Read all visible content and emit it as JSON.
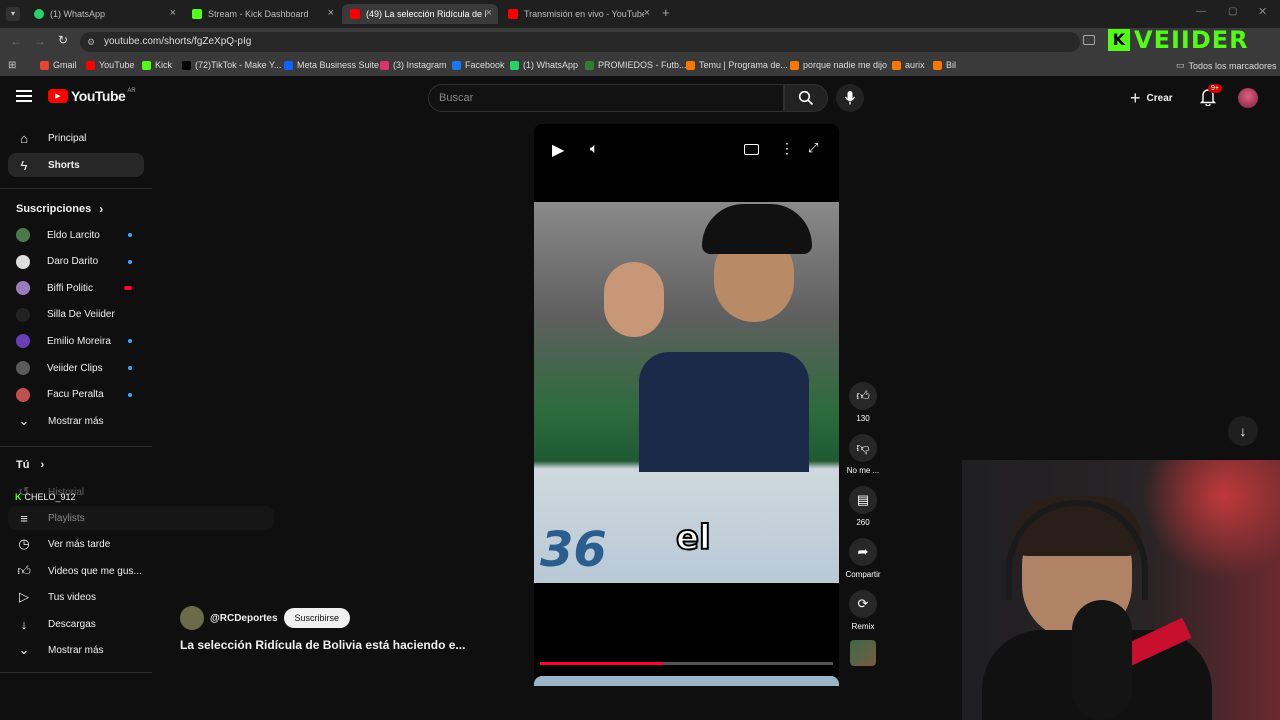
{
  "browser": {
    "tabs": [
      {
        "label": "(1) WhatsApp",
        "color": "#25d366"
      },
      {
        "label": "Stream - Kick Dashboard",
        "color": "#53fc18"
      },
      {
        "label": "(49) La selección Ridícula de Bo",
        "color": "#ff0000"
      },
      {
        "label": "Transmisión en vivo - YouTube",
        "color": "#ff0000"
      }
    ],
    "url": "youtube.com/shorts/fgZeXpQ-pIg",
    "bookmarks": [
      {
        "label": "Gmail",
        "color": "#ea4335"
      },
      {
        "label": "YouTube",
        "color": "#ff0000"
      },
      {
        "label": "Kick",
        "color": "#53fc18"
      },
      {
        "label": "(72)TikTok - Make Y...",
        "color": "#000000"
      },
      {
        "label": "Meta Business Suite",
        "color": "#0866ff"
      },
      {
        "label": "(3) Instagram",
        "color": "#e1306c"
      },
      {
        "label": "Facebook",
        "color": "#1877f2"
      },
      {
        "label": "(1) WhatsApp",
        "color": "#25d366"
      },
      {
        "label": "PROMIEDOS - Futb...",
        "color": "#2e7d32"
      },
      {
        "label": "Temu | Programa de...",
        "color": "#fb7701"
      },
      {
        "label": "porque nadie me dijo",
        "color": "#fb7701"
      },
      {
        "label": "aurix",
        "color": "#fb7701"
      },
      {
        "label": "Bil",
        "color": "#fb7701"
      }
    ],
    "all_bookmarks": "Todos los marcadores"
  },
  "overlay_brand": "VEIIDER",
  "youtube": {
    "logo": "YouTube",
    "region": "AR",
    "search_placeholder": "Buscar",
    "create_label": "Crear",
    "notif_badge": "9+"
  },
  "sidebar": {
    "main": [
      {
        "label": "Principal",
        "icon": "home-icon"
      },
      {
        "label": "Shorts",
        "icon": "shorts-icon"
      }
    ],
    "subs_title": "Suscripciones",
    "subs": [
      {
        "label": "Eldo Larcito",
        "color": "#4a7a4a"
      },
      {
        "label": "Daro Darito",
        "color": "#dddddd"
      },
      {
        "label": "Biffi Politic",
        "color": "#9a7bbd"
      },
      {
        "label": "Silla De Veiider",
        "color": "#222222"
      },
      {
        "label": "Emilio Moreira",
        "color": "#6a3fb5"
      },
      {
        "label": "Veiider Clips",
        "color": "#5a5a5a"
      },
      {
        "label": "Facu Peralta",
        "color": "#c0504d"
      }
    ],
    "show_more": "Mostrar más",
    "you_title": "Tú",
    "kick_user": "CHELO_912",
    "you_items": [
      {
        "label": "Historial",
        "icon": "history-icon"
      },
      {
        "label": "Playlists",
        "icon": "playlist-icon"
      },
      {
        "label": "Ver más tarde",
        "icon": "clock-icon"
      },
      {
        "label": "Videos que me gus...",
        "icon": "like-icon"
      },
      {
        "label": "Tus videos",
        "icon": "video-icon"
      },
      {
        "label": "Descargas",
        "icon": "download-icon"
      }
    ],
    "show_more_2": "Mostrar más"
  },
  "short": {
    "channel": "@RCDeportes",
    "subscribe": "Suscribirse",
    "title": "La selección Ridícula de Bolivia está haciendo e...",
    "caption": "el",
    "jersey_number": "36",
    "progress": 0.42
  },
  "actions": {
    "likes": "130",
    "dislike": "No me ...",
    "comments": "260",
    "share": "Compartir",
    "remix": "Remix"
  }
}
